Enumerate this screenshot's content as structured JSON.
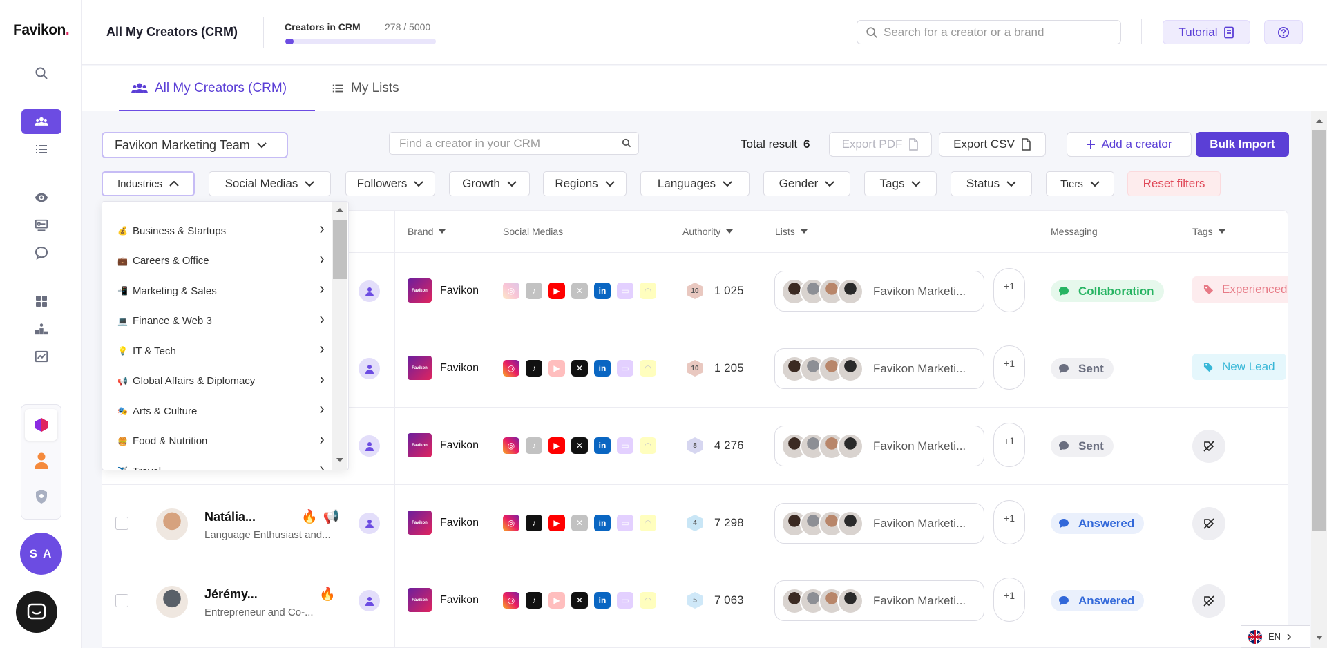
{
  "app": {
    "logo": "Favikon",
    "logo_dot": "."
  },
  "header": {
    "title": "All My Creators (CRM)",
    "crm_label": "Creators in CRM",
    "crm_count": "278 / 5000",
    "crm_progress": 0.0556,
    "search_placeholder": "Search for a creator or a brand",
    "tutorial_label": "Tutorial"
  },
  "tabs": [
    {
      "label": "All My Creators (CRM)",
      "active": true
    },
    {
      "label": "My Lists",
      "active": false
    }
  ],
  "toolbar": {
    "team": "Favikon Marketing Team",
    "crm_search_placeholder": "Find a creator in your CRM",
    "total_label": "Total result",
    "total_value": "6",
    "export_pdf": "Export PDF",
    "export_csv": "Export CSV",
    "add_creator": "Add a creator",
    "bulk_import": "Bulk Import"
  },
  "filters": [
    "Industries",
    "Social Medias",
    "Followers",
    "Growth",
    "Regions",
    "Languages",
    "Gender",
    "Tags",
    "Status",
    "Tiers"
  ],
  "reset_filters": "Reset filters",
  "dropdown": {
    "items": [
      {
        "emoji": "💰",
        "label": "Business & Startups"
      },
      {
        "emoji": "💼",
        "label": "Careers & Office"
      },
      {
        "emoji": "📲",
        "label": "Marketing & Sales"
      },
      {
        "emoji": "💻",
        "label": "Finance & Web 3"
      },
      {
        "emoji": "💡",
        "label": "IT & Tech"
      },
      {
        "emoji": "📢",
        "label": "Global Affairs & Diplomacy"
      },
      {
        "emoji": "🎭",
        "label": "Arts & Culture"
      },
      {
        "emoji": "🍔",
        "label": "Food & Nutrition"
      },
      {
        "emoji": "✈️",
        "label": "Travel"
      }
    ]
  },
  "table": {
    "columns": {
      "brand": "Brand",
      "social": "Social Medias",
      "authority": "Authority",
      "lists": "Lists",
      "messaging": "Messaging",
      "tags": "Tags"
    },
    "rows": [
      {
        "name": "",
        "subtitle": "",
        "brand": "Favikon",
        "authority": "1 025",
        "authority_level": "10",
        "list_name": "Favikon Marketi...",
        "list_more": "+1",
        "message": "Collaboration",
        "message_style": "green",
        "tag": "Experienced",
        "tag_style": "red",
        "socials": [
          false,
          false,
          true,
          false,
          true,
          false,
          false
        ]
      },
      {
        "name": "",
        "subtitle": "",
        "brand": "Favikon",
        "authority": "1 205",
        "authority_level": "10",
        "list_name": "Favikon Marketi...",
        "list_more": "+1",
        "message": "Sent",
        "message_style": "grey",
        "tag": "New Lead",
        "tag_style": "cyan",
        "socials": [
          true,
          true,
          false,
          true,
          true,
          false,
          false
        ]
      },
      {
        "name": "",
        "subtitle": "",
        "brand": "Favikon",
        "authority": "4 276",
        "authority_level": "8",
        "list_name": "Favikon Marketi...",
        "list_more": "+1",
        "message": "Sent",
        "message_style": "grey",
        "tag": "",
        "tag_style": "none",
        "socials": [
          true,
          false,
          true,
          true,
          true,
          false,
          false
        ]
      },
      {
        "name": "Natália...",
        "subtitle": "Language Enthusiast and...",
        "brand": "Favikon",
        "authority": "7 298",
        "authority_level": "4",
        "list_name": "Favikon Marketi...",
        "list_more": "+1",
        "message": "Answered",
        "message_style": "blue",
        "tag": "",
        "tag_style": "none",
        "socials": [
          true,
          true,
          true,
          false,
          true,
          false,
          false
        ]
      },
      {
        "name": "Jérémy...",
        "subtitle": "Entrepreneur and Co-...",
        "brand": "Favikon",
        "authority": "7 063",
        "authority_level": "5",
        "list_name": "Favikon Marketi...",
        "list_more": "+1",
        "message": "Answered",
        "message_style": "blue",
        "tag": "",
        "tag_style": "none",
        "socials": [
          true,
          true,
          false,
          true,
          true,
          false,
          false
        ]
      }
    ]
  },
  "user": {
    "initials": "S A"
  },
  "language": "EN",
  "colors": {
    "primary": "#5b3fd6",
    "accent": "#6c4ce2"
  }
}
